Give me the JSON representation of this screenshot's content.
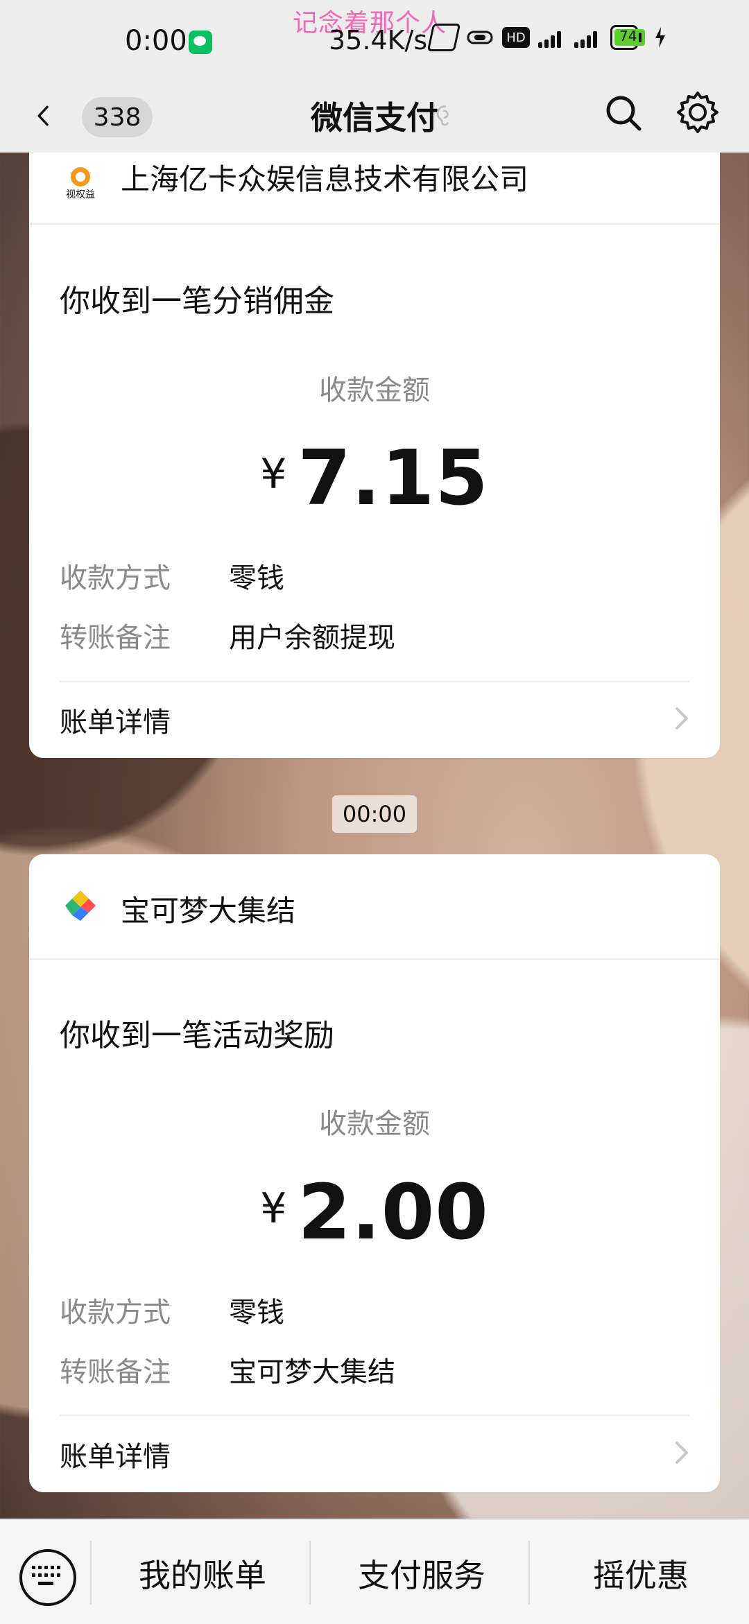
{
  "status_bar": {
    "time": "0:00",
    "network_speed": "35.4K/s",
    "overlay_text": "记念着那个人",
    "battery_level": 74
  },
  "app_bar": {
    "back_count": "338",
    "title": "微信支付"
  },
  "messages": [
    {
      "merchant": "上海亿卡众娱信息技术有限公司",
      "logo_text": "视权益",
      "title": "你收到一笔分销佣金",
      "amount_label": "收款金额",
      "currency": "¥",
      "amount": "7.15",
      "details": [
        {
          "label": "收款方式",
          "value": "零钱"
        },
        {
          "label": "转账备注",
          "value": "用户余额提现"
        }
      ],
      "bill_details": "账单详情"
    },
    {
      "merchant": "宝可梦大集结",
      "title": "你收到一笔活动奖励",
      "amount_label": "收款金额",
      "currency": "¥",
      "amount": "2.00",
      "details": [
        {
          "label": "收款方式",
          "value": "零钱"
        },
        {
          "label": "转账备注",
          "value": "宝可梦大集结"
        }
      ],
      "bill_details": "账单详情"
    }
  ],
  "timestamp_pill": "00:00",
  "bottom_menu": {
    "items": [
      "我的账单",
      "支付服务",
      "摇优惠"
    ]
  },
  "icons": {
    "back": "chevron-left-icon",
    "mute": "ear-icon",
    "search": "search-icon",
    "settings": "gear-icon",
    "keyboard": "keyboard-icon",
    "bill_arrow": "chevron-right-icon"
  },
  "colors": {
    "status_overlay_pink": "#f06ab6",
    "battery_green": "#5ccf2f",
    "wechat_green": "#07c160"
  }
}
